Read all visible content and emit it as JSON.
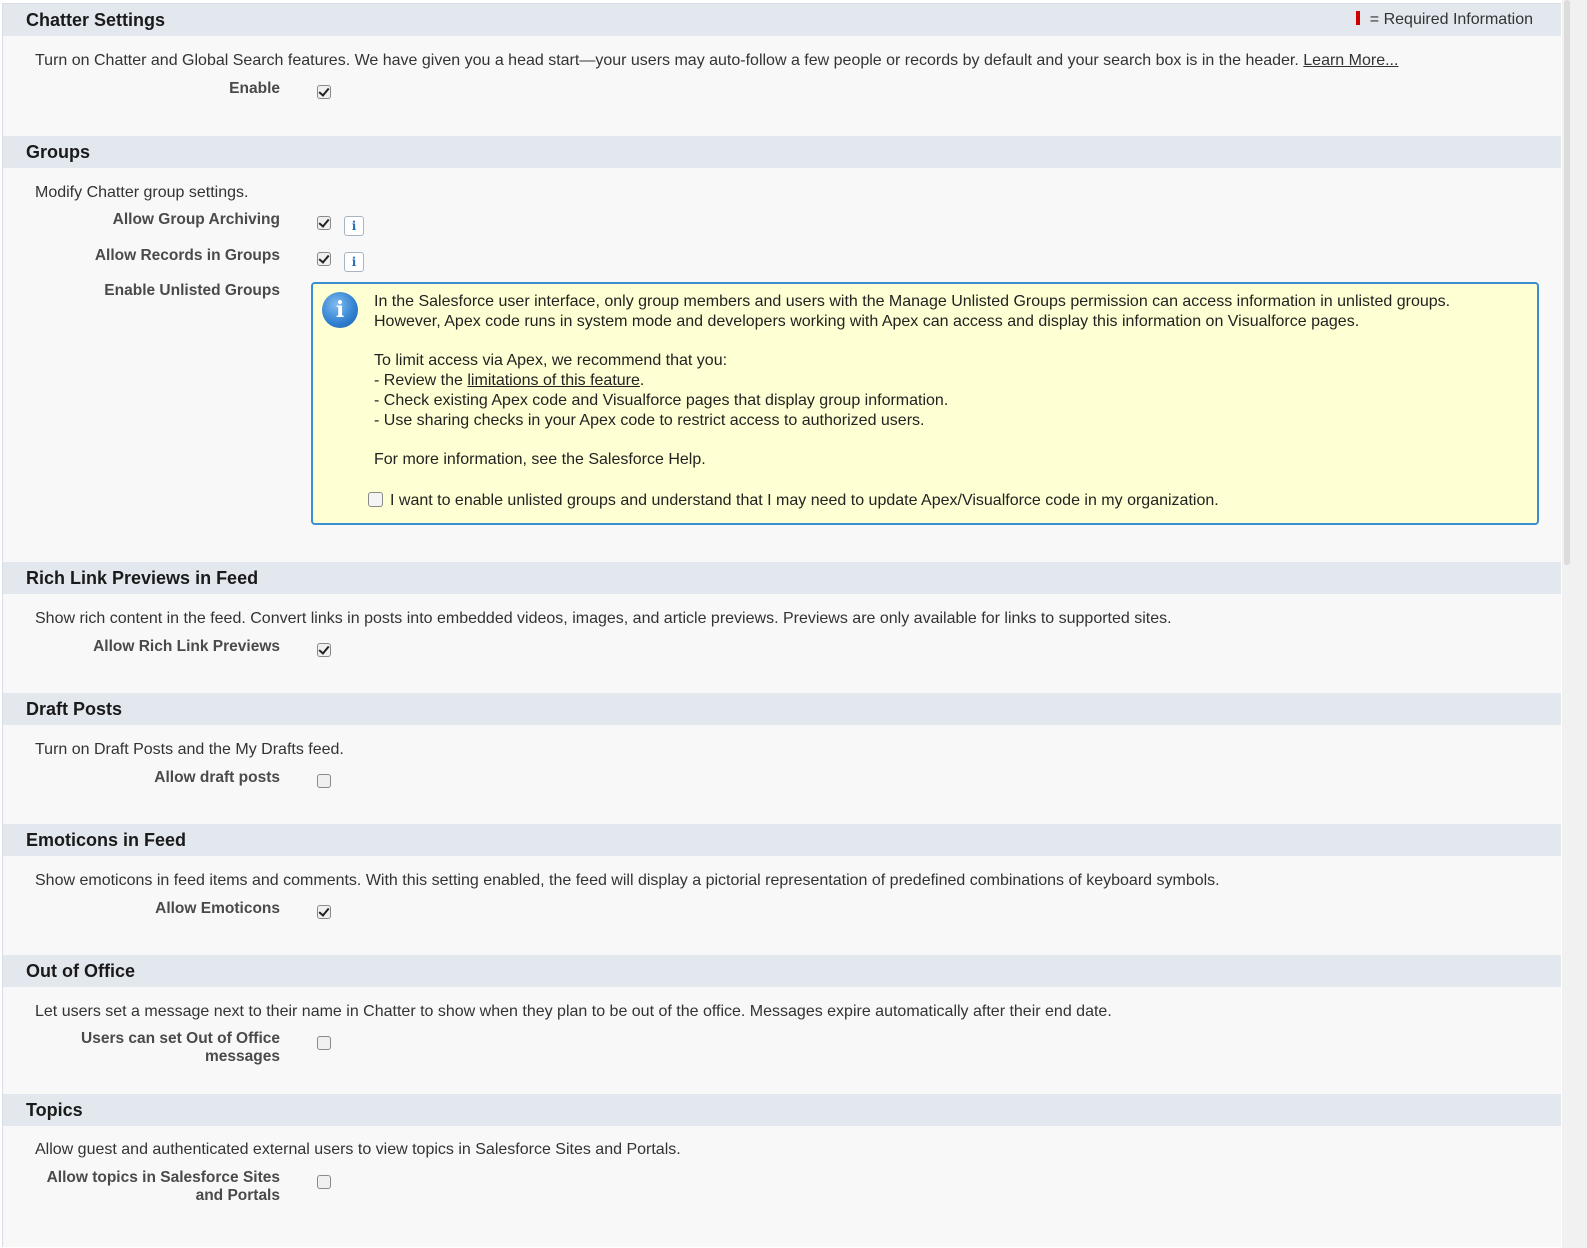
{
  "required_legend": "= Required Information",
  "sections": {
    "chatter": {
      "title": "Chatter Settings",
      "description": "Turn on Chatter and Global Search features. We have given you a head start—your users may auto-follow a few people or records by default and your search box is in the header.",
      "learn_more": "Learn More...",
      "fields": [
        {
          "label": "Enable",
          "checked": true
        }
      ]
    },
    "groups": {
      "title": "Groups",
      "description": "Modify Chatter group settings.",
      "fields": [
        {
          "label": "Allow Group Archiving",
          "checked": true,
          "info_icon": "i"
        },
        {
          "label": "Allow Records in Groups",
          "checked": true,
          "info_icon": "i"
        },
        {
          "label": "Enable Unlisted Groups"
        }
      ],
      "notice": {
        "icon": "i",
        "line1": "In the Salesforce user interface, only group members and users with the Manage Unlisted Groups permission can access information in unlisted groups.",
        "line2": "However, Apex code runs in system mode and developers working with Apex can access and display this information on Visualforce pages.",
        "line3": "To limit access via Apex, we recommend that you:",
        "line4_prefix": "- Review the ",
        "line4_link": "limitations of this feature",
        "line4_suffix": ".",
        "line5": "- Check existing Apex code and Visualforce pages that display group information.",
        "line6": "- Use sharing checks in your Apex code to restrict access to authorized users.",
        "line7": "For more information, see the Salesforce Help.",
        "checkbox_label": "I want to enable unlisted groups and understand that I may need to update Apex/Visualforce code in my organization.",
        "checkbox_checked": false
      }
    },
    "rich_links": {
      "title": "Rich Link Previews in Feed",
      "description": "Show rich content in the feed. Convert links in posts into embedded videos, images, and article previews. Previews are only available for links to supported sites.",
      "fields": [
        {
          "label": "Allow Rich Link Previews",
          "checked": true
        }
      ]
    },
    "drafts": {
      "title": "Draft Posts",
      "description": "Turn on Draft Posts and the My Drafts feed.",
      "fields": [
        {
          "label": "Allow draft posts",
          "checked": false
        }
      ]
    },
    "emoticons": {
      "title": "Emoticons in Feed",
      "description": "Show emoticons in feed items and comments. With this setting enabled, the feed will display a pictorial representation of predefined combinations of keyboard symbols.",
      "fields": [
        {
          "label": "Allow Emoticons",
          "checked": true
        }
      ]
    },
    "ooo": {
      "title": "Out of Office",
      "description": "Let users set a message next to their name in Chatter to show when they plan to be out of the office. Messages expire automatically after their end date.",
      "fields": [
        {
          "label_line1": "Users can set Out of Office",
          "label_line2": "messages",
          "checked": false
        }
      ]
    },
    "topics": {
      "title": "Topics",
      "description": "Allow guest and authenticated external users to view topics in Salesforce Sites and Portals.",
      "fields": [
        {
          "label_line1": "Allow topics in Salesforce Sites",
          "label_line2": "and Portals",
          "checked": false
        }
      ]
    }
  }
}
